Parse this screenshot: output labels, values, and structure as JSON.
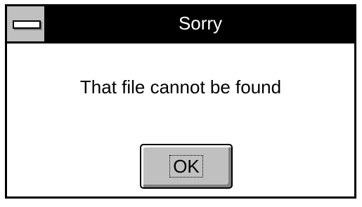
{
  "dialog": {
    "title": "Sorry",
    "message": "That file cannot be found",
    "ok_label": "OK"
  },
  "icons": {
    "system_menu": "system-menu-icon"
  },
  "colors": {
    "titlebar_bg": "#000000",
    "titlebar_text": "#ffffff",
    "button_face": "#c0c0c0",
    "window_bg": "#ffffff"
  }
}
